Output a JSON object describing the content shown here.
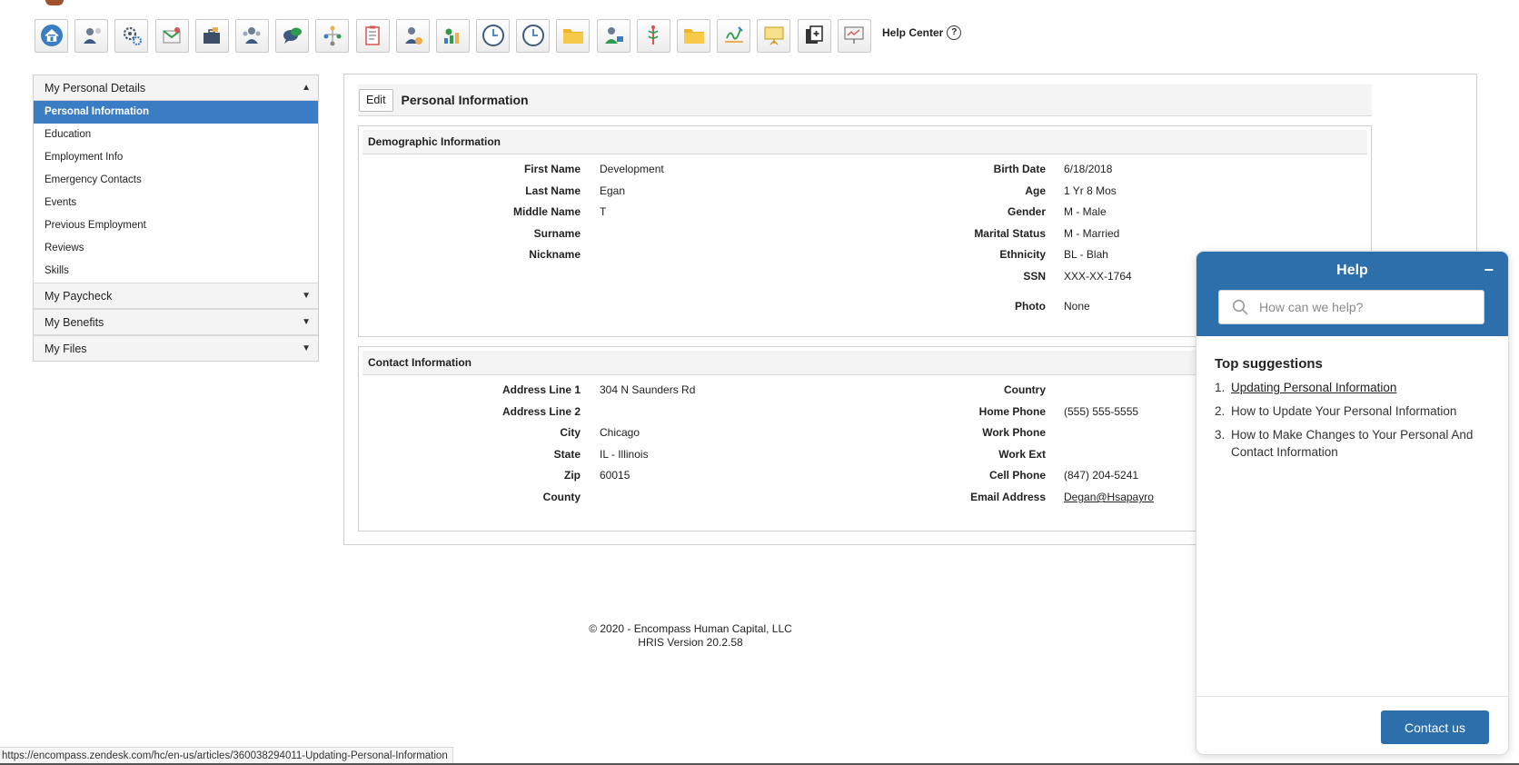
{
  "toolbar": {
    "icons": [
      "home-icon",
      "employee-profile-icon",
      "settings-gears-icon",
      "mail-icon",
      "briefcase-icon",
      "team-icon",
      "chat-icon",
      "org-chart-icon",
      "checklist-icon",
      "employee-info-icon",
      "benefits-icon",
      "clock-icon",
      "time-clock-icon",
      "folder-icon",
      "employee-manage-icon",
      "medical-icon",
      "documents-folder-icon",
      "signature-icon",
      "presentation-icon",
      "copy-document-icon",
      "training-board-icon"
    ],
    "help_center_label": "Help Center",
    "help_center_glyph": "?"
  },
  "leftnav": {
    "section1": "My Personal Details",
    "items": [
      "Personal Information",
      "Education",
      "Employment Info",
      "Emergency Contacts",
      "Events",
      "Previous Employment",
      "Reviews",
      "Skills"
    ],
    "active_index": 0,
    "section2": "My Paycheck",
    "section3": "My Benefits",
    "section4": "My Files",
    "caret_up": "▲",
    "caret_down": "▼"
  },
  "main": {
    "edit_label": "Edit",
    "title": "Personal Information",
    "demographic": {
      "title": "Demographic Information",
      "left": [
        {
          "label": "First Name",
          "value": "Development"
        },
        {
          "label": "Last Name",
          "value": "Egan"
        },
        {
          "label": "Middle Name",
          "value": "T"
        },
        {
          "label": "Surname",
          "value": ""
        },
        {
          "label": "Nickname",
          "value": ""
        }
      ],
      "right": [
        {
          "label": "Birth Date",
          "value": "6/18/2018"
        },
        {
          "label": "Age",
          "value": "1 Yr 8 Mos"
        },
        {
          "label": "Gender",
          "value": "M - Male"
        },
        {
          "label": "Marital Status",
          "value": "M - Married"
        },
        {
          "label": "Ethnicity",
          "value": "BL - Blah"
        },
        {
          "label": "SSN",
          "value": "XXX-XX-1764"
        },
        {
          "label": "Photo",
          "value": "None"
        }
      ]
    },
    "contact": {
      "title": "Contact Information",
      "left": [
        {
          "label": "Address Line 1",
          "value": "304 N Saunders Rd"
        },
        {
          "label": "Address Line 2",
          "value": ""
        },
        {
          "label": "City",
          "value": "Chicago"
        },
        {
          "label": "State",
          "value": "IL - Illinois"
        },
        {
          "label": "Zip",
          "value": "60015"
        },
        {
          "label": "County",
          "value": ""
        }
      ],
      "right": [
        {
          "label": "Country",
          "value": ""
        },
        {
          "label": "Home Phone",
          "value": "(555) 555-5555"
        },
        {
          "label": "Work Phone",
          "value": ""
        },
        {
          "label": "Work Ext",
          "value": ""
        },
        {
          "label": "Cell Phone",
          "value": "(847) 204-5241"
        },
        {
          "label": "Email Address",
          "value": "Degan@Hsapayro"
        }
      ]
    }
  },
  "footer": {
    "copyright": "© 2020 - Encompass Human Capital, LLC",
    "version": "HRIS Version 20.2.58"
  },
  "statusbar": {
    "url": "https://encompass.zendesk.com/hc/en-us/articles/360038294011-Updating-Personal-Information"
  },
  "help_widget": {
    "title": "Help",
    "minimize_glyph": "−",
    "search_placeholder": "How can we help?",
    "suggestions_title": "Top suggestions",
    "suggestions": [
      {
        "num": "1.",
        "text": "Updating Personal Information"
      },
      {
        "num": "2.",
        "text": "How to Update Your Personal Information"
      },
      {
        "num": "3.",
        "text": "How to Make Changes to Your Personal And Contact Information"
      }
    ],
    "contact_label": "Contact us"
  }
}
